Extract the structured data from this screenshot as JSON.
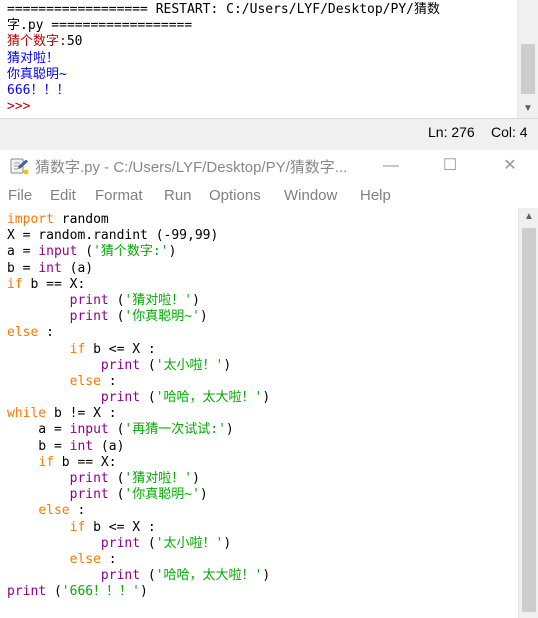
{
  "shell": {
    "lines": [
      {
        "text": "================== RESTART: C:/Users/LYF/Desktop/PY/猜数",
        "cls": "sh-restart"
      },
      {
        "text": "字.py ==================",
        "cls": "sh-restart"
      },
      {
        "text": "猜个数字:",
        "cls": "sh-red",
        "after": "50",
        "after_cls": "sh-prompt"
      },
      {
        "text": "猜对啦！",
        "cls": "sh-blue"
      },
      {
        "text": "你真聪明~",
        "cls": "sh-blue"
      },
      {
        "text": "666！！！",
        "cls": "sh-blue"
      },
      {
        "text": ">>> ",
        "cls": "sh-red"
      }
    ]
  },
  "status": {
    "line": "Ln: 276",
    "col": "Col: 4"
  },
  "window": {
    "title": "猜数字.py - C:/Users/LYF/Desktop/PY/猜数字...",
    "minimize": "—",
    "maximize": "☐",
    "close": "✕"
  },
  "menu": {
    "items": [
      "File",
      "Edit",
      "Format",
      "Run",
      "Options",
      "Window",
      "Help"
    ]
  },
  "code": [
    [
      [
        "kw",
        "import"
      ],
      [
        "pl",
        " random"
      ]
    ],
    [
      [
        "pl",
        "X = random.randint (-99,99)"
      ]
    ],
    [
      [
        "pl",
        "a = "
      ],
      [
        "bi",
        "input"
      ],
      [
        "pl",
        " ("
      ],
      [
        "st",
        "'猜个数字:'"
      ],
      [
        "pl",
        ")"
      ]
    ],
    [
      [
        "pl",
        "b = "
      ],
      [
        "bi",
        "int"
      ],
      [
        "pl",
        " (a)"
      ]
    ],
    [
      [
        "kw",
        "if"
      ],
      [
        "pl",
        " b == X:"
      ]
    ],
    [
      [
        "pl",
        "        "
      ],
      [
        "bi",
        "print"
      ],
      [
        "pl",
        " ("
      ],
      [
        "st",
        "'猜对啦！'"
      ],
      [
        "pl",
        ")"
      ]
    ],
    [
      [
        "pl",
        "        "
      ],
      [
        "bi",
        "print"
      ],
      [
        "pl",
        " ("
      ],
      [
        "st",
        "'你真聪明~'"
      ],
      [
        "pl",
        ")"
      ]
    ],
    [
      [
        "kw",
        "else"
      ],
      [
        "pl",
        " :"
      ]
    ],
    [
      [
        "pl",
        "        "
      ],
      [
        "kw",
        "if"
      ],
      [
        "pl",
        " b <= X :"
      ]
    ],
    [
      [
        "pl",
        "            "
      ],
      [
        "bi",
        "print"
      ],
      [
        "pl",
        " ("
      ],
      [
        "st",
        "'太小啦！'"
      ],
      [
        "pl",
        ")"
      ]
    ],
    [
      [
        "pl",
        "        "
      ],
      [
        "kw",
        "else"
      ],
      [
        "pl",
        " :"
      ]
    ],
    [
      [
        "pl",
        "            "
      ],
      [
        "bi",
        "print"
      ],
      [
        "pl",
        " ("
      ],
      [
        "st",
        "'哈哈，太大啦！'"
      ],
      [
        "pl",
        ")"
      ]
    ],
    [
      [
        "kw",
        "while"
      ],
      [
        "pl",
        " b != X :"
      ]
    ],
    [
      [
        "pl",
        "    a = "
      ],
      [
        "bi",
        "input"
      ],
      [
        "pl",
        " ("
      ],
      [
        "st",
        "'再猜一次试试:'"
      ],
      [
        "pl",
        ")"
      ]
    ],
    [
      [
        "pl",
        "    b = "
      ],
      [
        "bi",
        "int"
      ],
      [
        "pl",
        " (a)"
      ]
    ],
    [
      [
        "pl",
        "    "
      ],
      [
        "kw",
        "if"
      ],
      [
        "pl",
        " b == X:"
      ]
    ],
    [
      [
        "pl",
        "        "
      ],
      [
        "bi",
        "print"
      ],
      [
        "pl",
        " ("
      ],
      [
        "st",
        "'猜对啦！'"
      ],
      [
        "pl",
        ")"
      ]
    ],
    [
      [
        "pl",
        "        "
      ],
      [
        "bi",
        "print"
      ],
      [
        "pl",
        " ("
      ],
      [
        "st",
        "'你真聪明~'"
      ],
      [
        "pl",
        ")"
      ]
    ],
    [
      [
        "pl",
        "    "
      ],
      [
        "kw",
        "else"
      ],
      [
        "pl",
        " :"
      ]
    ],
    [
      [
        "pl",
        "        "
      ],
      [
        "kw",
        "if"
      ],
      [
        "pl",
        " b <= X :"
      ]
    ],
    [
      [
        "pl",
        "            "
      ],
      [
        "bi",
        "print"
      ],
      [
        "pl",
        " ("
      ],
      [
        "st",
        "'太小啦！'"
      ],
      [
        "pl",
        ")"
      ]
    ],
    [
      [
        "pl",
        "        "
      ],
      [
        "kw",
        "else"
      ],
      [
        "pl",
        " :"
      ]
    ],
    [
      [
        "pl",
        "            "
      ],
      [
        "bi",
        "print"
      ],
      [
        "pl",
        " ("
      ],
      [
        "st",
        "'哈哈，太大啦！'"
      ],
      [
        "pl",
        ")"
      ]
    ],
    [
      [
        "bi",
        "print"
      ],
      [
        "pl",
        " ("
      ],
      [
        "st",
        "'666！！！'"
      ],
      [
        "pl",
        ")"
      ]
    ]
  ],
  "colors": {
    "keyword": "#ff7700",
    "builtin": "#900090",
    "string": "#00aa00",
    "shell_output": "#0000ff",
    "shell_prompt": "#c00000"
  },
  "icons": {
    "app": "python-idle-icon",
    "scroll_up": "chevron-up-icon",
    "scroll_down": "chevron-down-icon"
  }
}
